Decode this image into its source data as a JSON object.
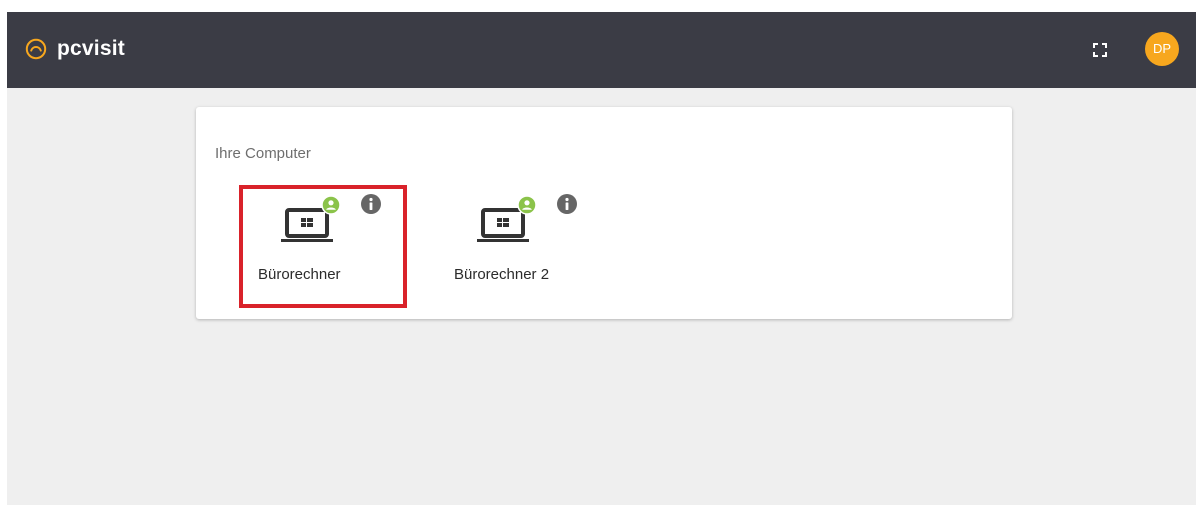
{
  "header": {
    "brand_name": "pcvisit",
    "logo_icon": "pcvisit-logo-icon",
    "fullscreen_icon": "fullscreen-icon",
    "avatar_initials": "DP",
    "avatar_color": "#f7a71e",
    "bar_color": "#3b3c45"
  },
  "computers": {
    "title": "Ihre Computer",
    "items": [
      {
        "name": "Bürorechner",
        "icon": "windows-laptop-icon",
        "status_icon": "user-online-icon",
        "status_color": "#8bc34a",
        "info_icon": "info-icon",
        "highlighted": true
      },
      {
        "name": "Bürorechner 2",
        "icon": "windows-laptop-icon",
        "status_icon": "user-online-icon",
        "status_color": "#8bc34a",
        "info_icon": "info-icon",
        "highlighted": false
      }
    ]
  },
  "highlight_color": "#d9222a"
}
